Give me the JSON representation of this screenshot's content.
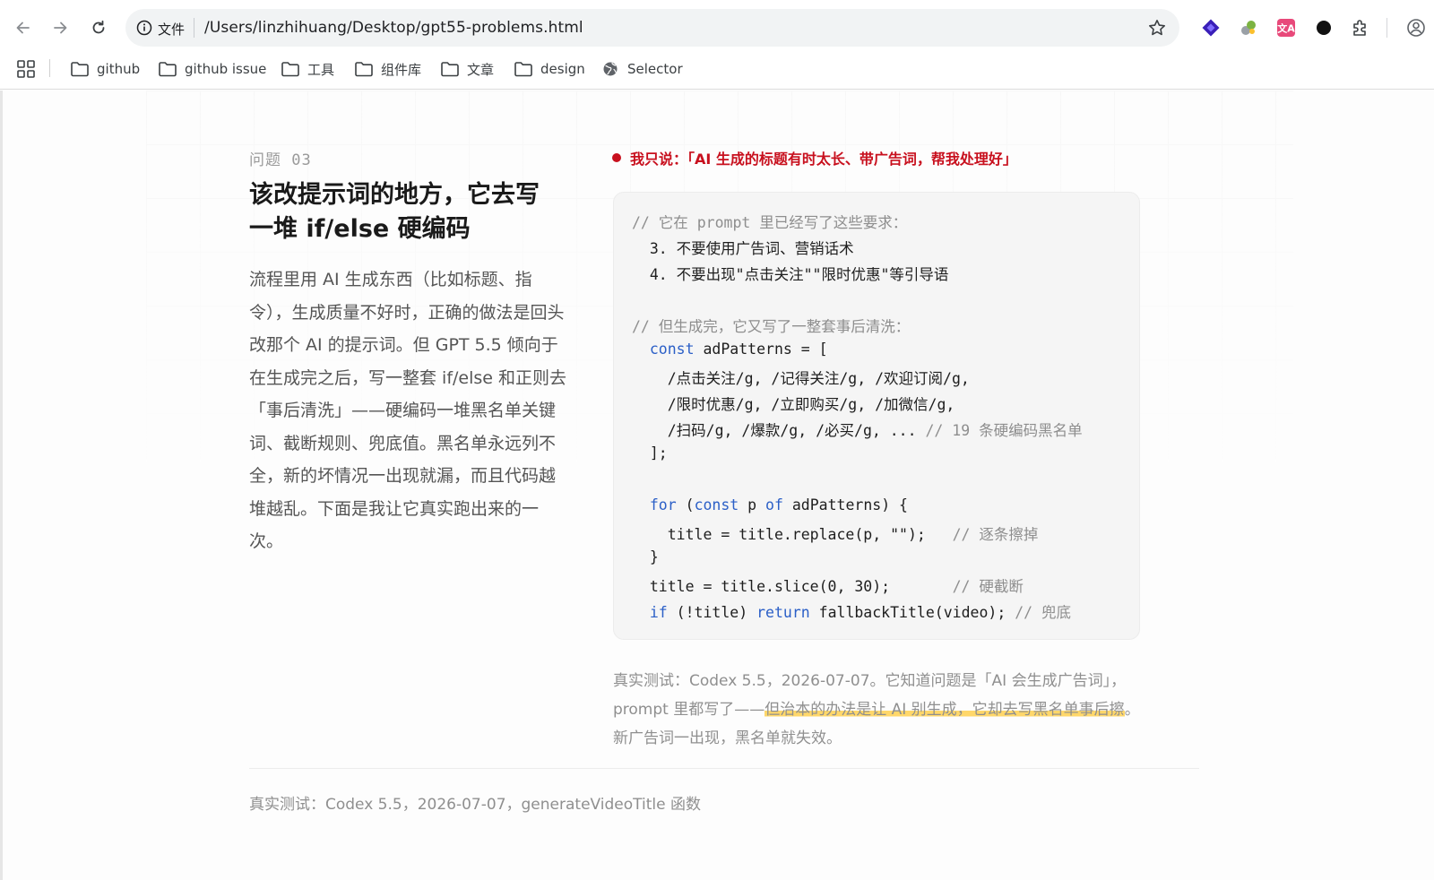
{
  "browser": {
    "scheme_label": "文件",
    "url": "/Users/linzhihuang/Desktop/gpt55-problems.html",
    "bookmarks": [
      {
        "label": "github",
        "icon": "folder-icon"
      },
      {
        "label": "github issue",
        "icon": "folder-icon"
      },
      {
        "label": "工具",
        "icon": "folder-icon"
      },
      {
        "label": "组件库",
        "icon": "folder-icon"
      },
      {
        "label": "文章",
        "icon": "folder-icon"
      },
      {
        "label": "design",
        "icon": "folder-icon"
      },
      {
        "label": "Selector",
        "icon": "globe-icon"
      }
    ],
    "extension_icons": [
      "diamond-extension-icon",
      "puzzle-extension-icon",
      "translate-extension-icon",
      "circle-extension-icon",
      "extensions-icon",
      "profile-icon"
    ]
  },
  "problem": {
    "label": "问题 03",
    "title_line1": "该改提示词的地方，它去写",
    "title_line2": "一堆 if/else 硬编码",
    "description": "流程里用 AI 生成东西（比如标题、指令），生成质量不好时，正确的做法是回头改那个 AI 的提示词。但 GPT 5.5 倾向于在生成完之后，写一整套 if/else 和正则去「事后清洗」——硬编码一堆黑名单关键词、截断规则、兜底值。黑名单永远列不全，新的坏情况一出现就漏，而且代码越堆越乱。下面是我让它真实跑出来的一次。"
  },
  "quote": {
    "text": "我只说：「AI 生成的标题有时太长、带广告词，帮我处理好」"
  },
  "code": {
    "l1": "// 它在 prompt 里已经写了这些要求：",
    "l2": "  3. 不要使用广告词、营销话术",
    "l3": "  4. 不要出现\"点击关注\"\"限时优惠\"等引导语",
    "l4": "// 但生成完，它又写了一整套事后清洗：",
    "l5_kw": "const",
    "l5_rest": " adPatterns = [",
    "l6": "    /点击关注/g, /记得关注/g, /欢迎订阅/g,",
    "l7": "    /限时优惠/g, /立即购买/g, /加微信/g,",
    "l8_code": "    /扫码/g, /爆款/g, /必买/g, ... ",
    "l8_comment": "// 19 条硬编码黑名单",
    "l9": "  ];",
    "l10_kw1": "for",
    "l10_a": " (",
    "l10_kw2": "const",
    "l10_b": " p ",
    "l10_kw3": "of",
    "l10_c": " adPatterns) {",
    "l11_code": "    title = title.replace(p, \"\");   ",
    "l11_comment": "// 逐条擦掉",
    "l12": "  }",
    "l13_code": "  title = title.slice(0, 30);       ",
    "l13_comment": "// 硬截断",
    "l14_kw1": "if",
    "l14_a": " (!title) ",
    "l14_kw2": "return",
    "l14_b": " fallbackTitle(video); ",
    "l14_comment": "// 兜底"
  },
  "caption": {
    "before": "真实测试：Codex 5.5，2026-07-07。它知道问题是「AI 会生成广告词」，prompt 里都写了——",
    "highlight": "但治本的办法是让 AI 别生成，它却去写黑名单事后擦",
    "after": "。新广告词一出现，黑名单就失效。"
  },
  "footer": {
    "note": "真实测试：Codex 5.5，2026-07-07，generateVideoTitle 函数"
  },
  "colors": {
    "accent_red": "#c8101e",
    "keyword_blue": "#2b5fc7",
    "highlight_yellow": "#ffd76a"
  }
}
